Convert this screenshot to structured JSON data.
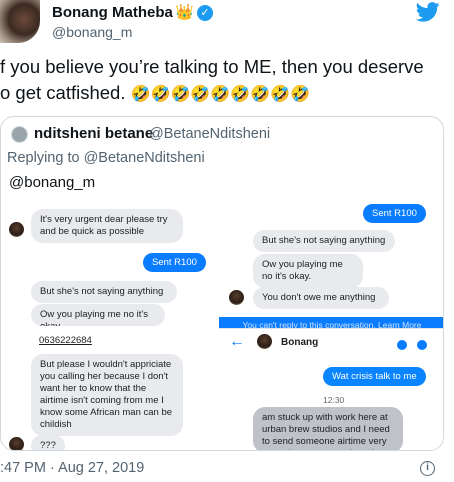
{
  "author": {
    "name": "Bonang Matheba",
    "handle": "@bonang_m",
    "badge_emoji": "👑"
  },
  "tweet": {
    "text_line1": "f you believe you’re talking to ME, then you deserve",
    "text_line2": "o get catfished.",
    "emojis": "🤣🤣🤣🤣🤣🤣🤣🤣🤣",
    "timestamp": ":47 PM · Aug 27, 2019"
  },
  "quote": {
    "name": "nditsheni betane",
    "handle": "@BetaneNditsheni",
    "replying_prefix": "Replying to",
    "replying_handle": "@BetaneNditsheni",
    "mention": "@bonang_m"
  },
  "left_chat": {
    "msg1": "It's very urgent dear please try and be quick as possible",
    "sent1": "Sent R100",
    "msg2": "But she's not saying anything",
    "msg3": "Ow you playing me no it's",
    "msg3_cut": "okay",
    "phone": "0636222684",
    "msg4": "But please I wouldn't appriciate you calling her because I don't want her to know that the airtime isn't coming from me I know some African man can be childish",
    "msg5": "???"
  },
  "right_chat": {
    "sent1": "Sent R100",
    "msg1": "But she's not saying anything",
    "msg2": "Ow you playing me no it's okay.",
    "msg3": "You don't owe me anything",
    "notice": "You can't reply to this conversation. Learn More",
    "contact": "Bonang",
    "out1": "Wat crisis talk to me",
    "time": "12:30",
    "msg4": "am stuck up with work here at urban brew studios and I need to send someone airtime very urgently my account is acting"
  },
  "colors": {
    "twitter_blue": "#1d9bf0",
    "messenger_blue": "#0a7cff",
    "bubble_gray": "#e9eaed"
  }
}
